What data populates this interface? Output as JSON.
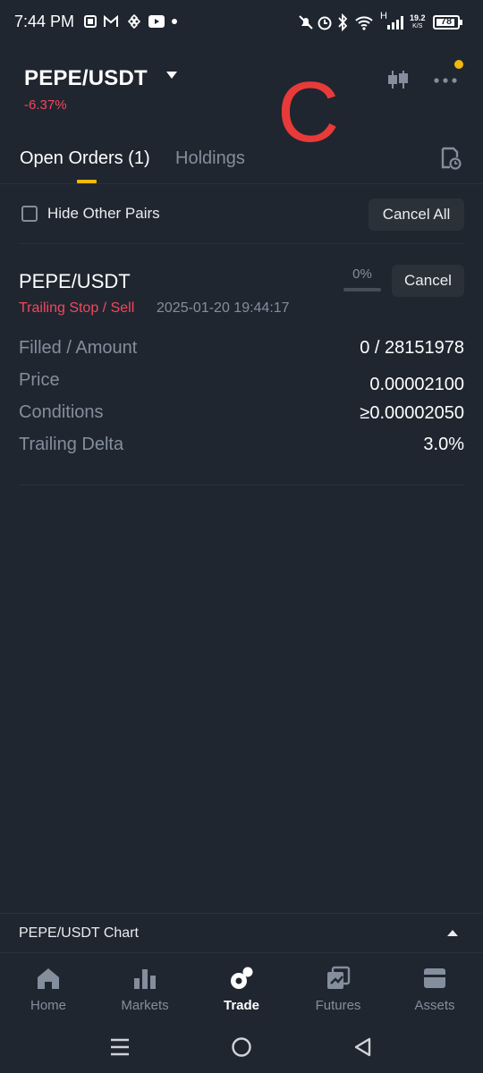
{
  "status_bar": {
    "time": "7:44 PM",
    "net_speed_value": "19.2",
    "net_speed_unit": "K/S",
    "battery": "78",
    "signal_label": "H",
    "left_icons": [
      "office-icon",
      "gmail-icon",
      "binance-icon",
      "youtube-icon",
      "dot-icon"
    ],
    "right_icons": [
      "mute-icon",
      "alarm-icon",
      "bluetooth-icon",
      "wifi-icon",
      "signal-icon",
      "battery-icon"
    ]
  },
  "header": {
    "pair": "PEPE/USDT",
    "change": "-6.37%",
    "overlay_letter": "C",
    "notification_color": "#f0b90b"
  },
  "tabs": {
    "open_orders": "Open Orders (1)",
    "holdings": "Holdings"
  },
  "filter": {
    "hide_other_pairs": "Hide Other Pairs",
    "cancel_all": "Cancel All"
  },
  "order": {
    "pair": "PEPE/USDT",
    "type": "Trailing Stop / Sell",
    "time": "2025-01-20 19:44:17",
    "progress_text": "0%",
    "progress_fraction": 0,
    "cancel": "Cancel",
    "rows": [
      {
        "label": "Filled / Amount",
        "value": "0 / 28151978"
      },
      {
        "label": "Price",
        "value": "0.00002100"
      },
      {
        "label": "Conditions",
        "value": "≥0.00002050"
      },
      {
        "label": "Trailing Delta",
        "value": "3.0%"
      }
    ]
  },
  "chart_bar": {
    "label": "PEPE/USDT Chart"
  },
  "bottom_nav": {
    "items": [
      {
        "label": "Home",
        "icon": "home-icon"
      },
      {
        "label": "Markets",
        "icon": "markets-icon"
      },
      {
        "label": "Trade",
        "icon": "trade-icon",
        "active": true
      },
      {
        "label": "Futures",
        "icon": "futures-icon"
      },
      {
        "label": "Assets",
        "icon": "assets-icon"
      }
    ]
  },
  "colors": {
    "background": "#1f2630",
    "accent": "#f0b90b",
    "sell_red": "#f6465d",
    "muted": "#848e9c"
  }
}
